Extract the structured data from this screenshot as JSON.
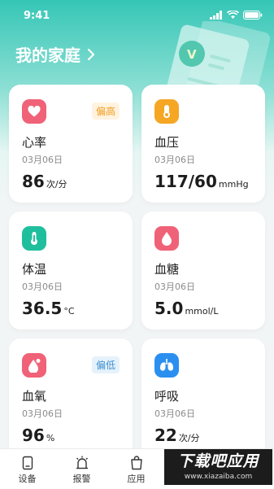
{
  "status": {
    "time": "9:41"
  },
  "header": {
    "title": "我的家庭"
  },
  "cards": [
    {
      "title": "心率",
      "date": "03月06日",
      "value": "86",
      "unit": "次/分",
      "badge": "偏高",
      "color": "#f06277"
    },
    {
      "title": "血压",
      "date": "03月06日",
      "value": "117/60",
      "unit": "mmHg",
      "badge": null,
      "color": "#f5a623"
    },
    {
      "title": "体温",
      "date": "03月06日",
      "value": "36.5",
      "unit": "°C",
      "badge": null,
      "color": "#1fbf9e"
    },
    {
      "title": "血糖",
      "date": "03月06日",
      "value": "5.0",
      "unit": "mmol/L",
      "badge": null,
      "color": "#f06277"
    },
    {
      "title": "血氧",
      "date": "03月06日",
      "value": "96",
      "unit": "%",
      "badge": "偏低",
      "color": "#f06277"
    },
    {
      "title": "呼吸",
      "date": "03月06日",
      "value": "22",
      "unit": "次/分",
      "badge": null,
      "color": "#2b8ff0"
    }
  ],
  "tabs": [
    {
      "label": "设备",
      "icon": "device-icon"
    },
    {
      "label": "报警",
      "icon": "alarm-icon"
    },
    {
      "label": "应用",
      "icon": "app-icon"
    }
  ],
  "watermark": {
    "text": "下载吧应用",
    "url": "www.xiazaiba.com"
  }
}
